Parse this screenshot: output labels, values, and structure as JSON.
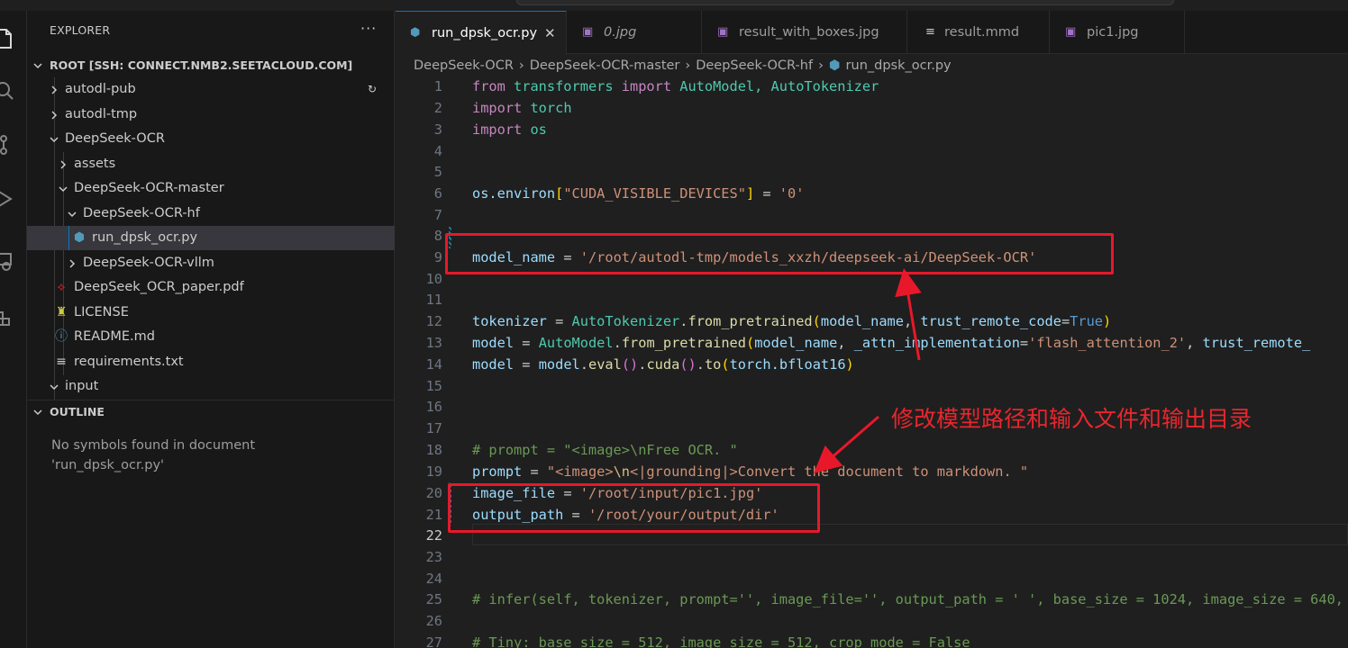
{
  "sidebar": {
    "header": "EXPLORER",
    "more": "···",
    "root_label": "ROOT [SSH: CONNECT.NMB2.SEETACLOUD.COM]",
    "items": [
      {
        "label": "autodl-pub"
      },
      {
        "label": "autodl-tmp"
      },
      {
        "label": "DeepSeek-OCR"
      },
      {
        "label": "assets"
      },
      {
        "label": "DeepSeek-OCR-master"
      },
      {
        "label": "DeepSeek-OCR-hf"
      },
      {
        "label": "run_dpsk_ocr.py"
      },
      {
        "label": "DeepSeek-OCR-vllm"
      },
      {
        "label": "DeepSeek_OCR_paper.pdf"
      },
      {
        "label": "LICENSE"
      },
      {
        "label": "README.md"
      },
      {
        "label": "requirements.txt"
      },
      {
        "label": "input"
      }
    ],
    "outline_header": "OUTLINE",
    "outline_message": "No symbols found in document 'run_dpsk_ocr.py'"
  },
  "tabs": [
    {
      "label": "run_dpsk_ocr.py",
      "icon": "python-icon",
      "active": true
    },
    {
      "label": "0.jpg",
      "icon": "image-icon"
    },
    {
      "label": "result_with_boxes.jpg",
      "icon": "image-icon"
    },
    {
      "label": "result.mmd",
      "icon": "text-lines-icon"
    },
    {
      "label": "pic1.jpg",
      "icon": "image-icon"
    }
  ],
  "breadcrumb": [
    "DeepSeek-OCR",
    "DeepSeek-OCR-master",
    "DeepSeek-OCR-hf",
    "run_dpsk_ocr.py"
  ],
  "editor": {
    "line_numbers": [
      "1",
      "2",
      "3",
      "4",
      "5",
      "6",
      "7",
      "8",
      "9",
      "10",
      "11",
      "12",
      "13",
      "14",
      "15",
      "16",
      "17",
      "18",
      "19",
      "20",
      "21",
      "22",
      "23",
      "24",
      "25",
      "26",
      "27"
    ],
    "current_line": "22",
    "code": {
      "l1": {
        "a": "from",
        "b": " transformers ",
        "c": "import",
        "d": " AutoModel, AutoTokenizer"
      },
      "l2": {
        "a": "import",
        "b": " torch"
      },
      "l3": {
        "a": "import",
        "b": " os"
      },
      "l6": {
        "a": "os.environ",
        "b": "[",
        "c": "\"CUDA_VISIBLE_DEVICES\"",
        "d": "]",
        "e": " = ",
        "f": "'0'"
      },
      "l9": {
        "a": "model_name",
        "b": " = ",
        "c": "'/root/autodl-tmp/models_xxzh/deepseek-ai/DeepSeek-OCR'"
      },
      "l12": {
        "a": "tokenizer",
        "b": " = ",
        "c": "AutoTokenizer",
        "d": ".",
        "e": "from_pretrained",
        "f": "(",
        "g": "model_name",
        "h": ", ",
        "i": "trust_remote_code",
        "j": "=",
        "k": "True",
        "l": ")"
      },
      "l13": {
        "a": "model",
        "b": " = ",
        "c": "AutoModel",
        "d": ".",
        "e": "from_pretrained",
        "f": "(",
        "g": "model_name",
        "h": ", ",
        "i": "_attn_implementation",
        "j": "=",
        "k": "'flash_attention_2'",
        "l": ", ",
        "m": "trust_remote_"
      },
      "l14": {
        "a": "model",
        "b": " = ",
        "c": "model",
        "d": ".",
        "e": "eval",
        "f": "()",
        "g": ".",
        "h": "cuda",
        "i": "()",
        "j": ".",
        "k": "to",
        "l": "(",
        "m": "torch",
        "n": ".bfloat16",
        "o": ")"
      },
      "l18": "# prompt = \"<image>\\nFree OCR. \"",
      "l19": {
        "a": "prompt",
        "b": " = ",
        "c": "\"",
        "d": "<image>",
        "e": "\\n",
        "f": "<|grounding|>Convert the document to markdown. \""
      },
      "l20": {
        "a": "image_file",
        "b": " = ",
        "c": "'/root/input/pic1.jpg'"
      },
      "l21": {
        "a": "output_path",
        "b": " = ",
        "c": "'/root/your/output/dir'"
      },
      "l25": "# infer(self, tokenizer, prompt='', image_file='', output_path = ' ', base_size = 1024, image_size = 640,",
      "l27": "# Tiny: base_size = 512, image_size = 512, crop_mode = False"
    }
  },
  "annotation": {
    "text": "修改模型路径和输入文件和输出目录",
    "color": "#e8182a"
  }
}
